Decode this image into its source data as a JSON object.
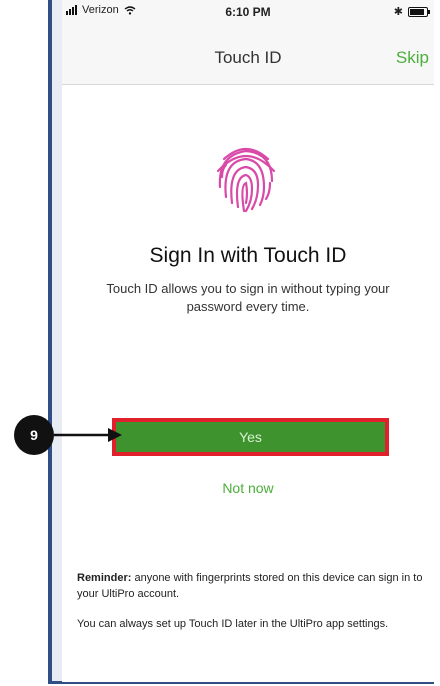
{
  "status_bar": {
    "carrier": "Verizon",
    "time": "6:10 PM"
  },
  "nav": {
    "title": "Touch ID",
    "skip_label": "Skip"
  },
  "content": {
    "title": "Sign In with Touch ID",
    "description": "Touch ID allows you to sign in without typing your password every time."
  },
  "buttons": {
    "yes_label": "Yes",
    "not_now_label": "Not now"
  },
  "reminder": {
    "bold_prefix": "Reminder:",
    "text": " anyone with fingerprints stored on this device can sign in to your UltiPro account.",
    "text2": "You can always set up Touch ID later in the UltiPro app settings."
  },
  "callout": {
    "step_number": "9"
  },
  "colors": {
    "accent_green": "#4caf3b",
    "button_green": "#3f932f",
    "highlight_red": "#e0202a",
    "frame_blue": "#2f4f86",
    "fingerprint_pink": "#d94aa8"
  },
  "icons": {
    "fingerprint": "fingerprint-icon",
    "wifi": "wifi-icon",
    "battery": "battery-icon",
    "bluetooth": "bluetooth-icon",
    "signal": "signal-bars-icon",
    "arrow": "arrow-right-icon"
  }
}
